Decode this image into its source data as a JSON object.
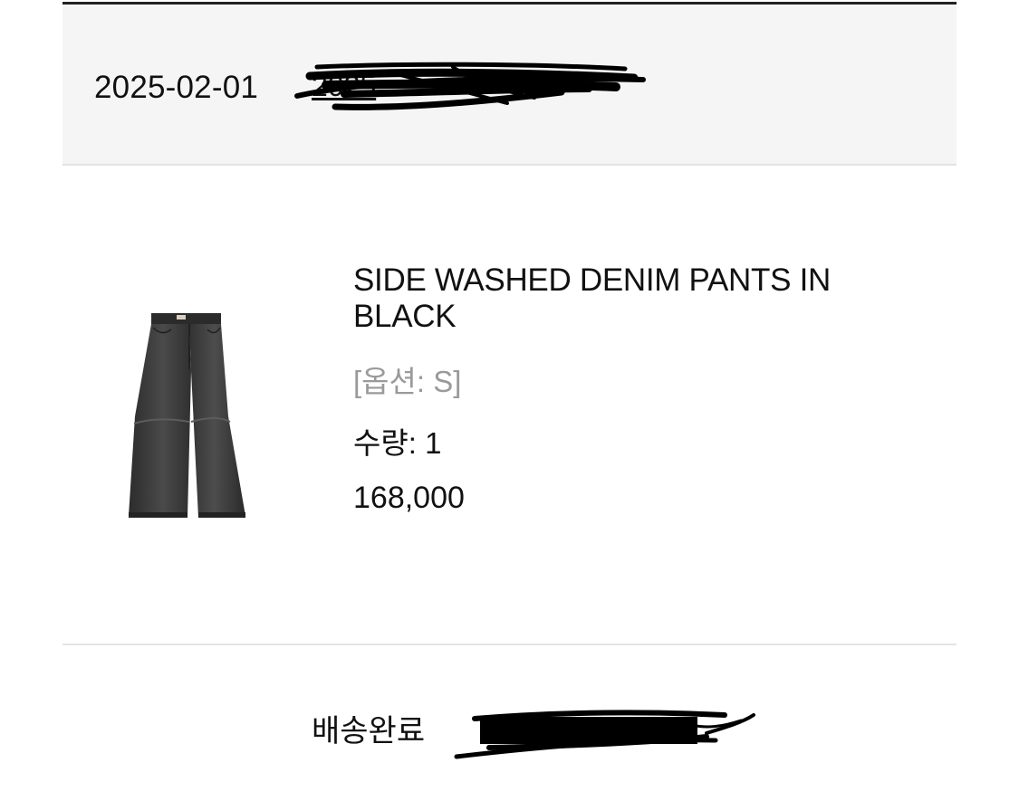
{
  "order": {
    "date": "2025-02-01",
    "number": "2025"
  },
  "product": {
    "name": "SIDE WASHED DENIM PANTS IN BLACK",
    "option": "[옵션: S]",
    "quantity_label": "수량: ",
    "quantity": "1",
    "price": "168,000",
    "image_icon": "black-denim-pants-photo"
  },
  "delivery": {
    "status": "배송완료"
  },
  "colors": {
    "header_bg": "#f5f5f5",
    "top_border": "#222222",
    "divider": "#e3e3e3",
    "muted_text": "#9a9a9a",
    "redaction_ink": "#000000"
  }
}
